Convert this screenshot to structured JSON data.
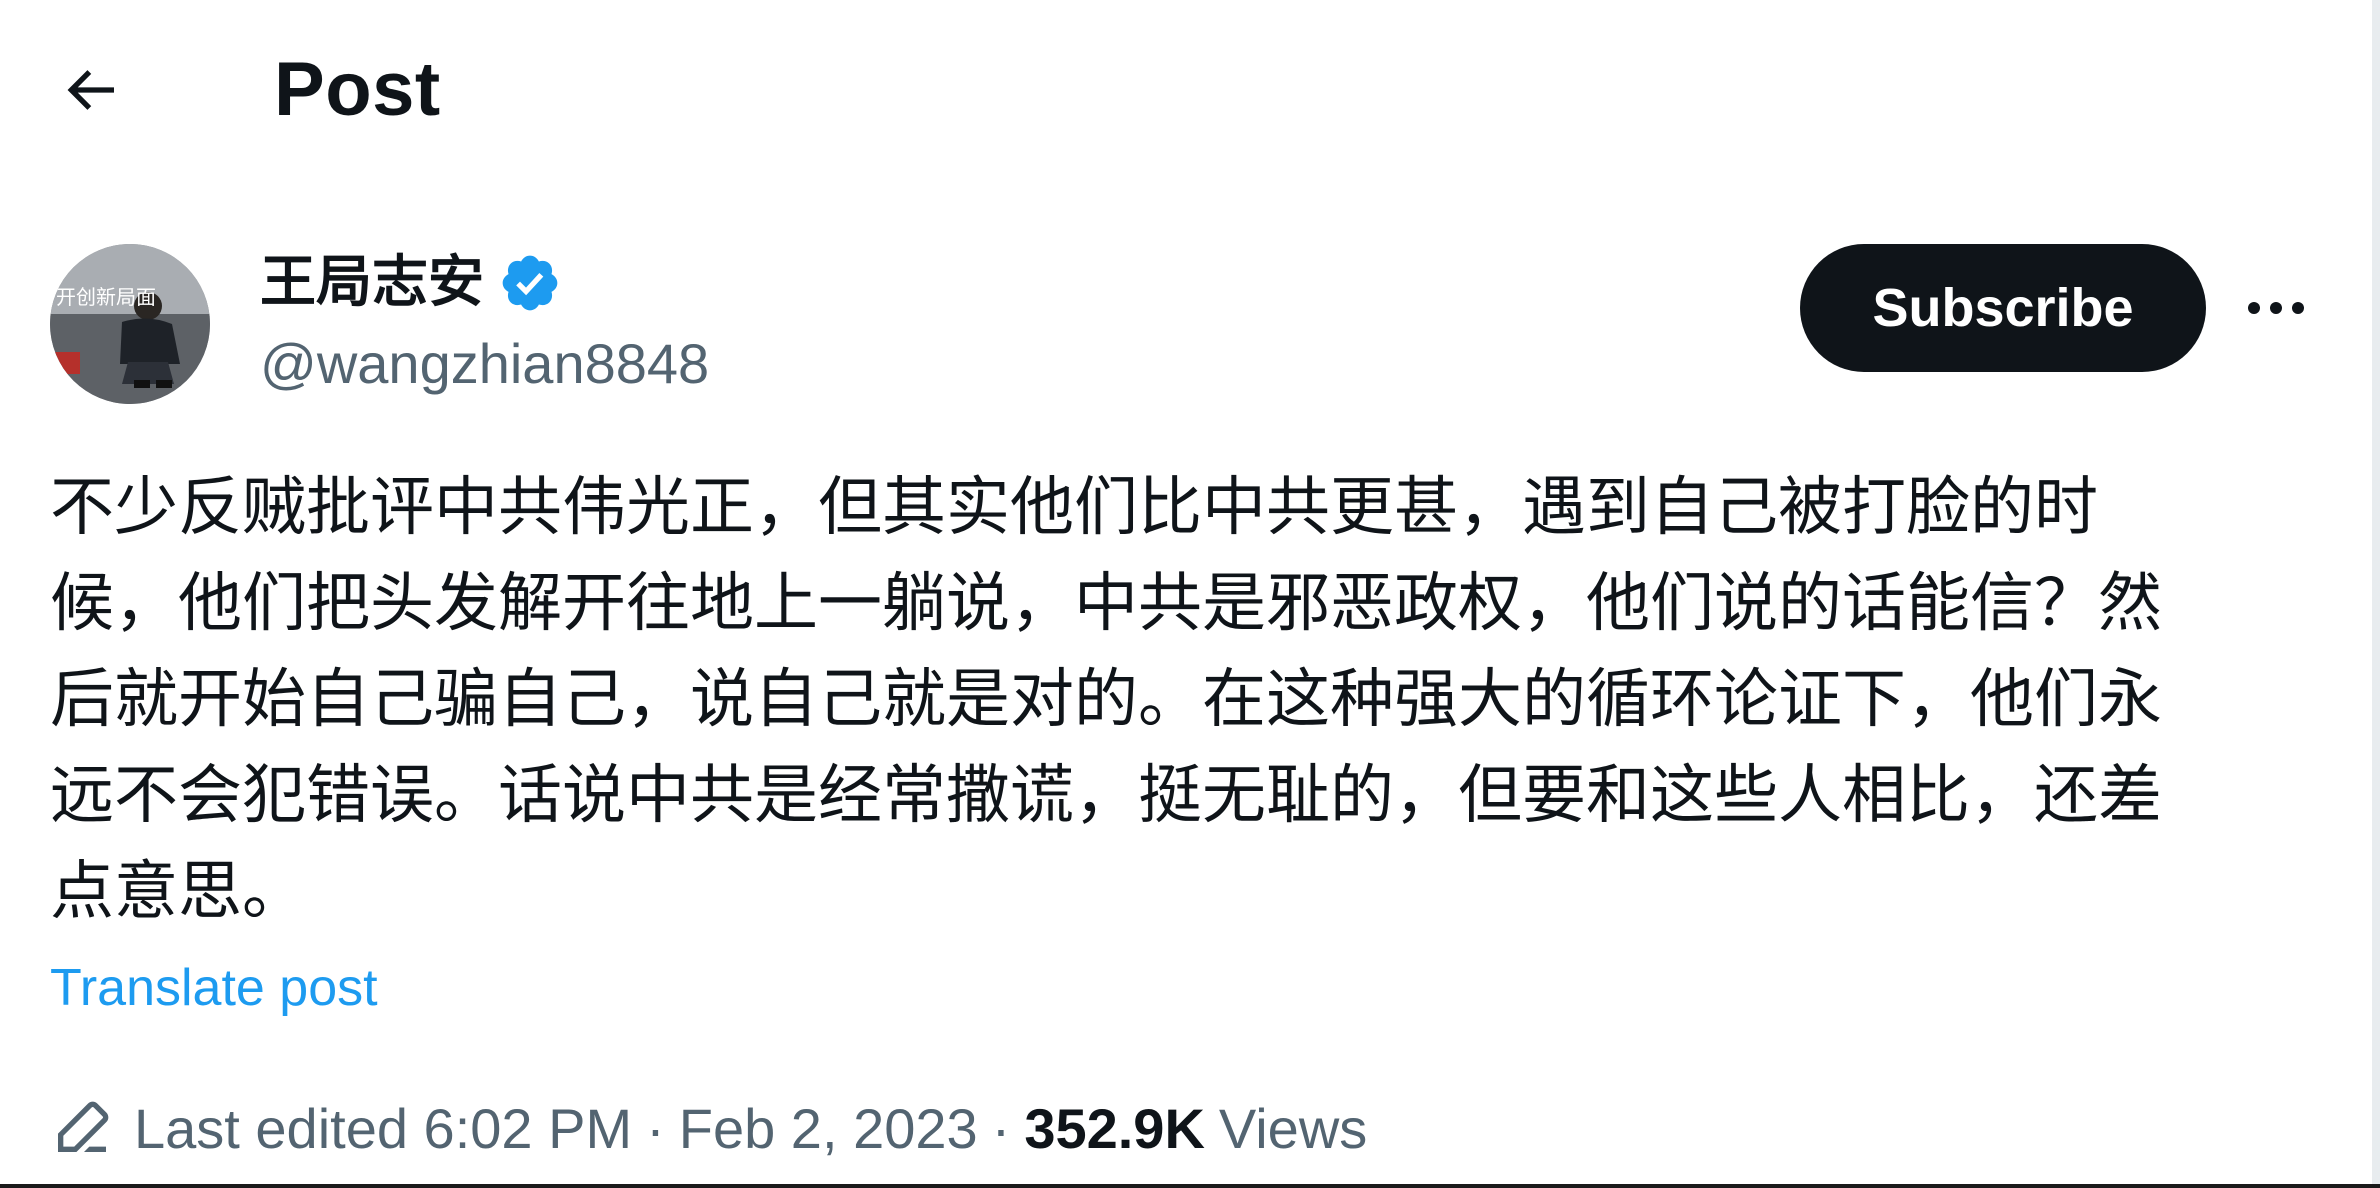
{
  "header": {
    "title": "Post"
  },
  "author": {
    "display_name": "王局志安",
    "handle": "@wangzhian8848",
    "verified": true,
    "avatar_overlay_text": "开创新局面"
  },
  "actions": {
    "subscribe_label": "Subscribe"
  },
  "post": {
    "text": "不少反贼批评中共伟光正，但其实他们比中共更甚，遇到自己被打脸的时\n候，他们把头发解开往地上一躺说，中共是邪恶政权，他们说的话能信？然\n后就开始自己骗自己，说自己就是对的。在这种强大的循环论证下，他们永\n远不会犯错误。话说中共是经常撒谎，挺无耻的，但要和这些人相比，还差\n点意思。",
    "translate_label": "Translate post"
  },
  "meta": {
    "edited_text": "Last edited 6:02 PM",
    "separator": "·",
    "date": "Feb 2, 2023",
    "views_count": "352.9K",
    "views_label": "Views"
  },
  "colors": {
    "text_primary": "#0f1419",
    "text_secondary": "#536471",
    "link": "#1d9bf0",
    "verified": "#1d9bf0",
    "button_bg": "#0f1419",
    "button_text": "#ffffff"
  },
  "icons": {
    "back": "arrow-left-icon",
    "verified": "verified-badge-icon",
    "more": "more-horizontal-icon",
    "edit": "pencil-icon"
  }
}
